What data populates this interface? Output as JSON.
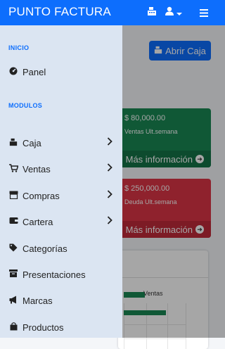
{
  "topbar": {
    "brand": "PUNTO FACTURA",
    "icons": [
      "cash-register-icon",
      "user-icon",
      "caret-down-icon",
      "hamburger-menu-icon"
    ]
  },
  "content": {
    "abrir_caja_label": "Abrir Caja",
    "cards": [
      {
        "amount": "$ 80,000.00",
        "label": "Ventas Ult.semana",
        "more": "Más información",
        "color": "#198754"
      },
      {
        "amount": "$ 250,000.00",
        "label": "Deuda Ult.semana",
        "more": "Más información",
        "color": "#dc3545"
      }
    ],
    "chart": {
      "legend": "Ventas"
    }
  },
  "chart_data": {
    "type": "bar",
    "categories": [],
    "series": [
      {
        "name": "Ventas",
        "values": []
      }
    ]
  },
  "sidebar": {
    "sections": {
      "inicio": "INICIO",
      "modulos": "MODULOS"
    },
    "panel": {
      "label": "Panel",
      "icon": "gauge-icon"
    },
    "items": [
      {
        "label": "Caja",
        "icon": "cash-register-icon",
        "has_submenu": true
      },
      {
        "label": "Ventas",
        "icon": "cart-icon",
        "has_submenu": true
      },
      {
        "label": "Compras",
        "icon": "store-icon",
        "has_submenu": true
      },
      {
        "label": "Cartera",
        "icon": "wallet-icon",
        "has_submenu": true
      },
      {
        "label": "Categorías",
        "icon": "tag-icon",
        "has_submenu": false
      },
      {
        "label": "Presentaciones",
        "icon": "archive-box-icon",
        "has_submenu": false
      },
      {
        "label": "Marcas",
        "icon": "megaphone-icon",
        "has_submenu": false
      },
      {
        "label": "Productos",
        "icon": "shopping-bag-icon",
        "has_submenu": false
      }
    ]
  },
  "colors": {
    "primary": "#0d6efd",
    "success": "#198754",
    "danger": "#dc3545",
    "sidebar_bg": "#dbe5f2"
  }
}
